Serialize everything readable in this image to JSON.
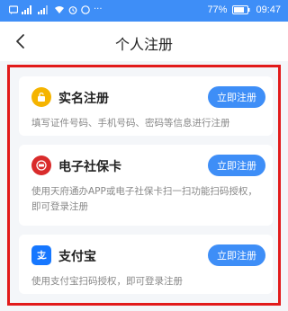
{
  "status_bar": {
    "battery": "77%",
    "time": "09:47"
  },
  "header": {
    "title": "个人注册"
  },
  "cards": [
    {
      "title": "实名注册",
      "button": "立即注册",
      "description": "填写证件号码、手机号码、密码等信息进行注册",
      "icon": "lock-icon",
      "icon_color": "#f5b400"
    },
    {
      "title": "电子社保卡",
      "button": "立即注册",
      "description": "使用天府通办APP或电子社保卡扫一扫功能扫码授权，即可登录注册",
      "icon": "social-security-card-icon",
      "icon_color": "#d92b2b"
    },
    {
      "title": "支付宝",
      "button": "立即注册",
      "description": "使用支付宝扫码授权，即可登录注册",
      "icon": "alipay-icon",
      "icon_color": "#1677ff"
    }
  ]
}
